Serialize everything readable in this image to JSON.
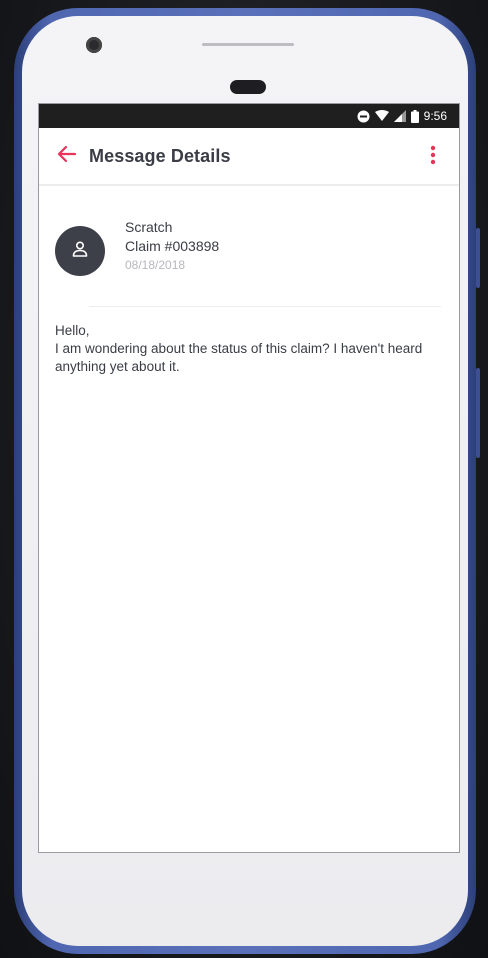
{
  "status_bar": {
    "time": "9:56",
    "icons": [
      "do-not-disturb-icon",
      "wifi-icon",
      "cell-signal-icon",
      "battery-icon"
    ]
  },
  "app_bar": {
    "title": "Message Details",
    "back_icon": "arrow-left-icon",
    "menu_icon": "more-vertical-icon"
  },
  "message": {
    "subject": "Scratch",
    "claim": "Claim #003898",
    "date": "08/18/2018",
    "greeting": "Hello,",
    "body": "I am wondering about the status of this claim? I haven't heard anything yet about it."
  },
  "colors": {
    "accent": "#e8335a",
    "text": "#3b3d46",
    "muted": "#b5b7bd",
    "avatar_bg": "#3d4049",
    "status_bar_bg": "#1f1f1f",
    "device_frame": "#5a71ba"
  }
}
